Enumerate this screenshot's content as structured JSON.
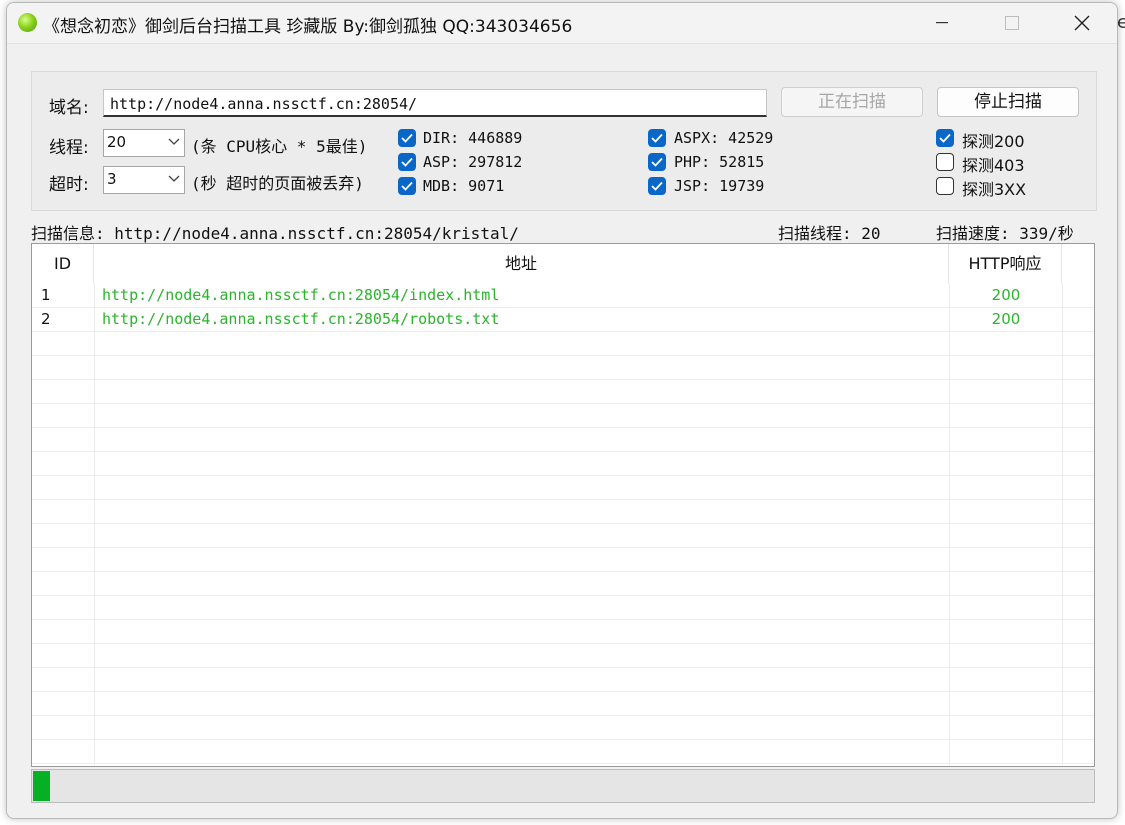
{
  "window": {
    "title": "《想念初恋》御剑后台扫描工具 珍藏版 By:御剑孤独 QQ:343034656",
    "minimize": "minimize",
    "maximize": "maximize",
    "close": "close"
  },
  "form": {
    "domain_label": "域名:",
    "domain_value": "http://node4.anna.nssctf.cn:28054/",
    "scan_button": "正在扫描",
    "stop_button": "停止扫描",
    "threads_label": "线程:",
    "threads_value": "20",
    "threads_hint": "(条 CPU核心 * 5最佳)",
    "timeout_label": "超时:",
    "timeout_value": "3",
    "timeout_hint": "(秒 超时的页面被丢弃)"
  },
  "dicts": [
    {
      "label": "DIR: 446889",
      "checked": true
    },
    {
      "label": "ASP: 297812",
      "checked": true
    },
    {
      "label": "MDB: 9071",
      "checked": true
    },
    {
      "label": "ASPX: 42529",
      "checked": true
    },
    {
      "label": "PHP: 52815",
      "checked": true
    },
    {
      "label": "JSP: 19739",
      "checked": true
    }
  ],
  "probes": [
    {
      "label": "探测200",
      "checked": true
    },
    {
      "label": "探测403",
      "checked": false
    },
    {
      "label": "探测3XX",
      "checked": false
    }
  ],
  "status": {
    "info": "扫描信息: http://node4.anna.nssctf.cn:28054/kristal/",
    "threads": "扫描线程: 20",
    "speed": "扫描速度: 339/秒"
  },
  "table": {
    "columns": [
      "ID",
      "地址",
      "HTTP响应"
    ],
    "rows": [
      {
        "id": "1",
        "url": "http://node4.anna.nssctf.cn:28054/index.html",
        "code": "200"
      },
      {
        "id": "2",
        "url": "http://node4.anna.nssctf.cn:28054/robots.txt",
        "code": "200"
      }
    ]
  },
  "progress": 0.016,
  "colors": {
    "check": "#0a67c8",
    "result": "#2bb52b",
    "progress": "#06b025"
  }
}
